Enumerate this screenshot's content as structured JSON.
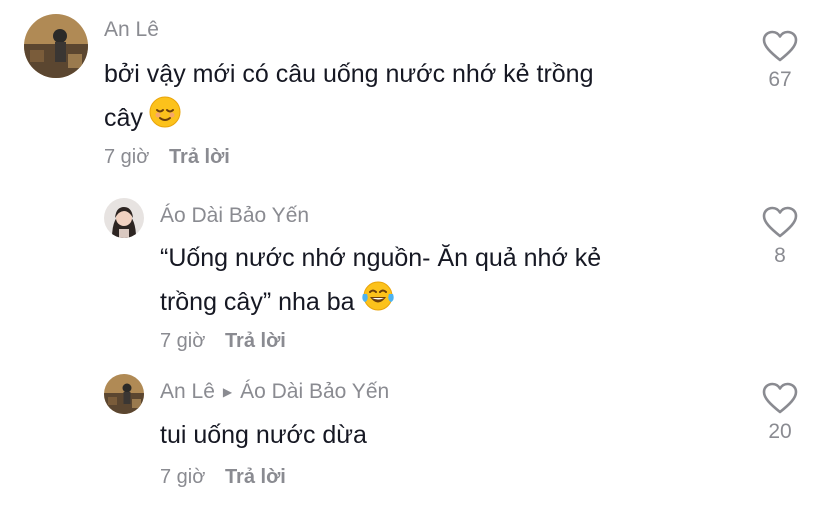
{
  "comments": [
    {
      "author": "An Lê",
      "line1": "bởi vậy mới có câu uống nước nhớ kẻ trồng",
      "line2": "cây",
      "emoji": "relieved-face-emoji",
      "time": "7 giờ",
      "reply": "Trả lời",
      "likes": "67"
    },
    {
      "author": "Áo Dài Bảo Yến",
      "line1": "“Uống nước nhớ nguồn- Ăn quả nhớ kẻ",
      "line2": "trồng cây” nha ba",
      "emoji": "tears-of-joy-emoji",
      "time": "7 giờ",
      "reply": "Trả lời",
      "likes": "8"
    },
    {
      "author": "An Lê",
      "reply_to": "Áo Dài Bảo Yến",
      "line1": "tui uống nước dừa",
      "time": "7 giờ",
      "reply": "Trả lời",
      "likes": "20"
    }
  ]
}
